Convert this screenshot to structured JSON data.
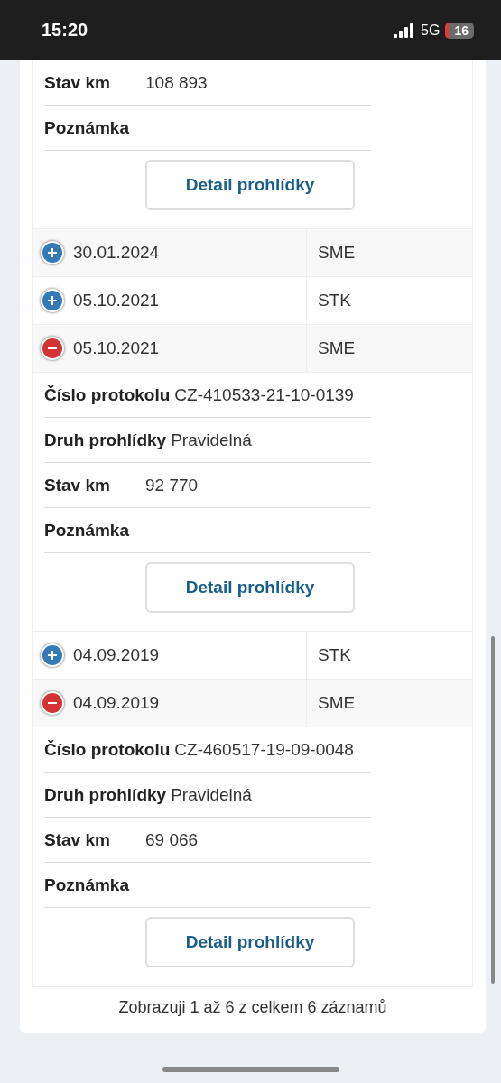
{
  "status_bar": {
    "time": "15:20",
    "network": "5G",
    "battery": "16"
  },
  "leading_detail": {
    "fields": [
      {
        "label": "Stav km",
        "value": "108 893"
      },
      {
        "label": "Poznámka"
      }
    ],
    "button": "Detail prohlídky"
  },
  "rows": [
    {
      "date": "30.01.2024",
      "type": "SME",
      "expanded": false
    },
    {
      "date": "05.10.2021",
      "type": "STK",
      "expanded": false
    },
    {
      "date": "05.10.2021",
      "type": "SME",
      "expanded": true,
      "detail": {
        "fields": [
          {
            "label": "Číslo protokolu",
            "value": "CZ-410533-21-10-0139"
          },
          {
            "label": "Druh prohlídky",
            "value": "Pravidelná"
          },
          {
            "label": "Stav km",
            "value": "92 770"
          },
          {
            "label": "Poznámka"
          }
        ],
        "button": "Detail prohlídky"
      }
    },
    {
      "date": "04.09.2019",
      "type": "STK",
      "expanded": false
    },
    {
      "date": "04.09.2019",
      "type": "SME",
      "expanded": true,
      "detail": {
        "fields": [
          {
            "label": "Číslo protokolu",
            "value": "CZ-460517-19-09-0048"
          },
          {
            "label": "Druh prohlídky",
            "value": "Pravidelná"
          },
          {
            "label": "Stav km",
            "value": "69 066"
          },
          {
            "label": "Poznámka"
          }
        ],
        "button": "Detail prohlídky"
      }
    }
  ],
  "footer": "Zobrazuji 1 až 6 z celkem 6 záznamů"
}
